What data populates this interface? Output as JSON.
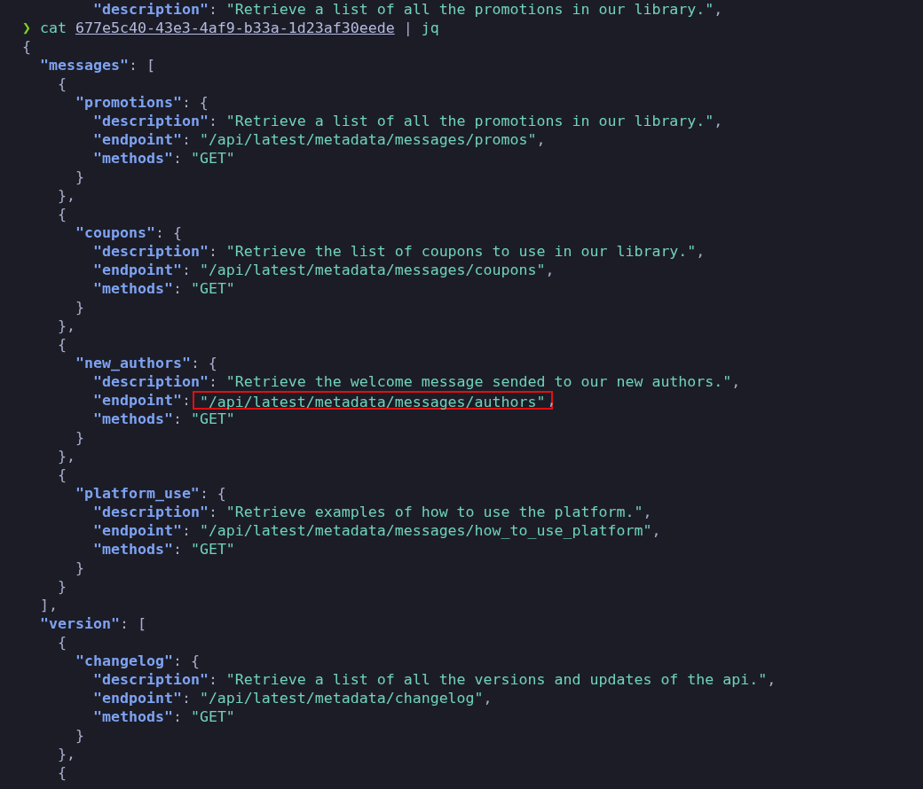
{
  "previous_output_line": [
    {
      "kind": "key",
      "text": "\"description\""
    },
    {
      "kind": "punct",
      "text": ": "
    },
    {
      "kind": "string",
      "text": "\"Retrieve a list of all the promotions in our library.\""
    },
    {
      "kind": "punct",
      "text": ","
    }
  ],
  "prompt": {
    "symbol": "❯",
    "command": "cat",
    "argument": "677e5c40-43e3-4af9-b33a-1d23af30eede",
    "pipe": "|",
    "pipe_command": "jq"
  },
  "output": {
    "open": [
      {
        "kind": "punct",
        "text": "{"
      }
    ],
    "children": [
      {
        "open": [
          {
            "kind": "key",
            "text": "\"messages\""
          },
          {
            "kind": "punct",
            "text": ": ["
          }
        ],
        "close": [
          {
            "kind": "punct",
            "text": "],"
          }
        ],
        "children": [
          {
            "open": [
              {
                "kind": "punct",
                "text": "{"
              }
            ],
            "close": [
              {
                "kind": "punct",
                "text": "},"
              }
            ],
            "children": [
              {
                "open": [
                  {
                    "kind": "key",
                    "text": "\"promotions\""
                  },
                  {
                    "kind": "punct",
                    "text": ": {"
                  }
                ],
                "close": [
                  {
                    "kind": "punct",
                    "text": "}"
                  }
                ],
                "children": [
                  {
                    "tokens": [
                      {
                        "kind": "key",
                        "text": "\"description\""
                      },
                      {
                        "kind": "punct",
                        "text": ": "
                      },
                      {
                        "kind": "string",
                        "text": "\"Retrieve a list of all the promotions in our library.\""
                      },
                      {
                        "kind": "punct",
                        "text": ","
                      }
                    ]
                  },
                  {
                    "tokens": [
                      {
                        "kind": "key",
                        "text": "\"endpoint\""
                      },
                      {
                        "kind": "punct",
                        "text": ": "
                      },
                      {
                        "kind": "string",
                        "text": "\"/api/latest/metadata/messages/promos\""
                      },
                      {
                        "kind": "punct",
                        "text": ","
                      }
                    ]
                  },
                  {
                    "tokens": [
                      {
                        "kind": "key",
                        "text": "\"methods\""
                      },
                      {
                        "kind": "punct",
                        "text": ": "
                      },
                      {
                        "kind": "string",
                        "text": "\"GET\""
                      }
                    ]
                  }
                ]
              }
            ]
          },
          {
            "open": [
              {
                "kind": "punct",
                "text": "{"
              }
            ],
            "close": [
              {
                "kind": "punct",
                "text": "},"
              }
            ],
            "children": [
              {
                "open": [
                  {
                    "kind": "key",
                    "text": "\"coupons\""
                  },
                  {
                    "kind": "punct",
                    "text": ": {"
                  }
                ],
                "close": [
                  {
                    "kind": "punct",
                    "text": "}"
                  }
                ],
                "children": [
                  {
                    "tokens": [
                      {
                        "kind": "key",
                        "text": "\"description\""
                      },
                      {
                        "kind": "punct",
                        "text": ": "
                      },
                      {
                        "kind": "string",
                        "text": "\"Retrieve the list of coupons to use in our library.\""
                      },
                      {
                        "kind": "punct",
                        "text": ","
                      }
                    ]
                  },
                  {
                    "tokens": [
                      {
                        "kind": "key",
                        "text": "\"endpoint\""
                      },
                      {
                        "kind": "punct",
                        "text": ": "
                      },
                      {
                        "kind": "string",
                        "text": "\"/api/latest/metadata/messages/coupons\""
                      },
                      {
                        "kind": "punct",
                        "text": ","
                      }
                    ]
                  },
                  {
                    "tokens": [
                      {
                        "kind": "key",
                        "text": "\"methods\""
                      },
                      {
                        "kind": "punct",
                        "text": ": "
                      },
                      {
                        "kind": "string",
                        "text": "\"GET\""
                      }
                    ]
                  }
                ]
              }
            ]
          },
          {
            "open": [
              {
                "kind": "punct",
                "text": "{"
              }
            ],
            "close": [
              {
                "kind": "punct",
                "text": "},"
              }
            ],
            "children": [
              {
                "open": [
                  {
                    "kind": "key",
                    "text": "\"new_authors\""
                  },
                  {
                    "kind": "punct",
                    "text": ": {"
                  }
                ],
                "close": [
                  {
                    "kind": "punct",
                    "text": "}"
                  }
                ],
                "children": [
                  {
                    "tokens": [
                      {
                        "kind": "key",
                        "text": "\"description\""
                      },
                      {
                        "kind": "punct",
                        "text": ": "
                      },
                      {
                        "kind": "string",
                        "text": "\"Retrieve the welcome message sended to our new authors.\""
                      },
                      {
                        "kind": "punct",
                        "text": ","
                      }
                    ]
                  },
                  {
                    "tokens": [
                      {
                        "kind": "key",
                        "text": "\"endpoint\""
                      },
                      {
                        "kind": "punct",
                        "text": ": "
                      },
                      {
                        "kind": "marked_string",
                        "text": "\"/api/latest/metadata/messages/authors\""
                      },
                      {
                        "kind": "punct",
                        "text": ","
                      }
                    ]
                  },
                  {
                    "tokens": [
                      {
                        "kind": "key",
                        "text": "\"methods\""
                      },
                      {
                        "kind": "punct",
                        "text": ": "
                      },
                      {
                        "kind": "string",
                        "text": "\"GET\""
                      }
                    ]
                  }
                ]
              }
            ]
          },
          {
            "open": [
              {
                "kind": "punct",
                "text": "{"
              }
            ],
            "close": [
              {
                "kind": "punct",
                "text": "}"
              }
            ],
            "children": [
              {
                "open": [
                  {
                    "kind": "key",
                    "text": "\"platform_use\""
                  },
                  {
                    "kind": "punct",
                    "text": ": {"
                  }
                ],
                "close": [
                  {
                    "kind": "punct",
                    "text": "}"
                  }
                ],
                "children": [
                  {
                    "tokens": [
                      {
                        "kind": "key",
                        "text": "\"description\""
                      },
                      {
                        "kind": "punct",
                        "text": ": "
                      },
                      {
                        "kind": "string",
                        "text": "\"Retrieve examples of how to use the platform.\""
                      },
                      {
                        "kind": "punct",
                        "text": ","
                      }
                    ]
                  },
                  {
                    "tokens": [
                      {
                        "kind": "key",
                        "text": "\"endpoint\""
                      },
                      {
                        "kind": "punct",
                        "text": ": "
                      },
                      {
                        "kind": "string",
                        "text": "\"/api/latest/metadata/messages/how_to_use_platform\""
                      },
                      {
                        "kind": "punct",
                        "text": ","
                      }
                    ]
                  },
                  {
                    "tokens": [
                      {
                        "kind": "key",
                        "text": "\"methods\""
                      },
                      {
                        "kind": "punct",
                        "text": ": "
                      },
                      {
                        "kind": "string",
                        "text": "\"GET\""
                      }
                    ]
                  }
                ]
              }
            ]
          }
        ]
      },
      {
        "open": [
          {
            "kind": "key",
            "text": "\"version\""
          },
          {
            "kind": "punct",
            "text": ": ["
          }
        ],
        "children": [
          {
            "open": [
              {
                "kind": "punct",
                "text": "{"
              }
            ],
            "close": [
              {
                "kind": "punct",
                "text": "},"
              }
            ],
            "children": [
              {
                "open": [
                  {
                    "kind": "key",
                    "text": "\"changelog\""
                  },
                  {
                    "kind": "punct",
                    "text": ": {"
                  }
                ],
                "close": [
                  {
                    "kind": "punct",
                    "text": "}"
                  }
                ],
                "children": [
                  {
                    "tokens": [
                      {
                        "kind": "key",
                        "text": "\"description\""
                      },
                      {
                        "kind": "punct",
                        "text": ": "
                      },
                      {
                        "kind": "string",
                        "text": "\"Retrieve a list of all the versions and updates of the api.\""
                      },
                      {
                        "kind": "punct",
                        "text": ","
                      }
                    ]
                  },
                  {
                    "tokens": [
                      {
                        "kind": "key",
                        "text": "\"endpoint\""
                      },
                      {
                        "kind": "punct",
                        "text": ": "
                      },
                      {
                        "kind": "string",
                        "text": "\"/api/latest/metadata/changelog\""
                      },
                      {
                        "kind": "punct",
                        "text": ","
                      }
                    ]
                  },
                  {
                    "tokens": [
                      {
                        "kind": "key",
                        "text": "\"methods\""
                      },
                      {
                        "kind": "punct",
                        "text": ": "
                      },
                      {
                        "kind": "string",
                        "text": "\"GET\""
                      }
                    ]
                  }
                ]
              }
            ]
          },
          {
            "open": [
              {
                "kind": "punct",
                "text": "{"
              }
            ]
          }
        ]
      }
    ]
  }
}
